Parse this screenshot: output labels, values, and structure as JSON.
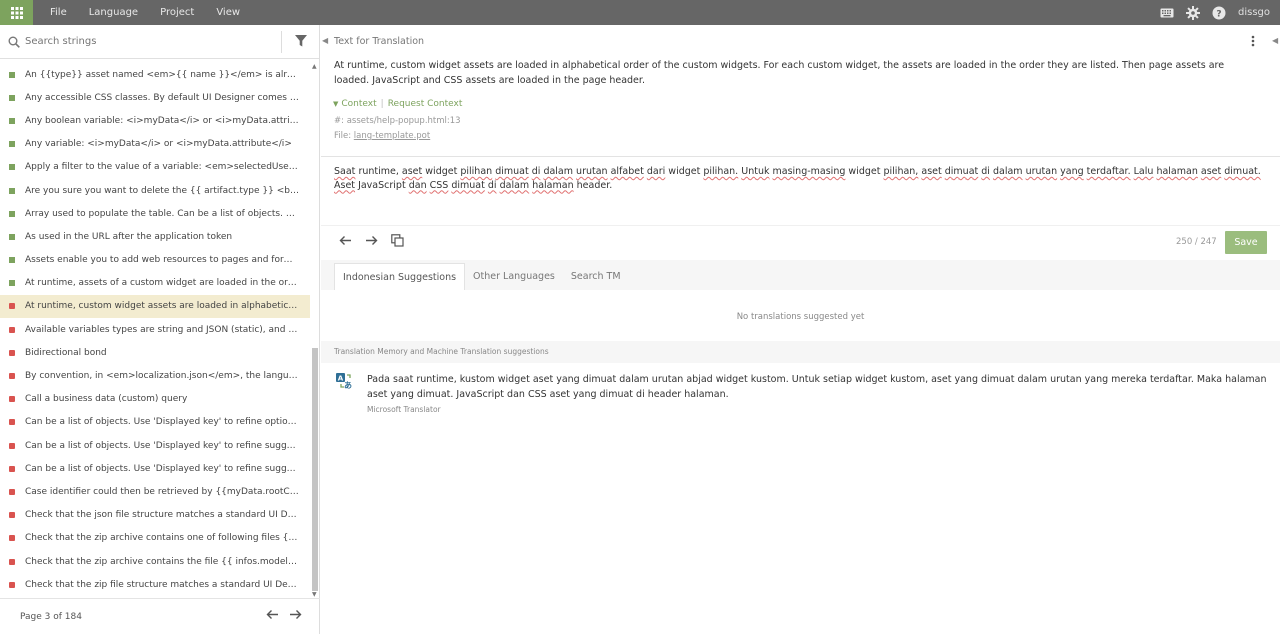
{
  "topbar": {
    "menu": [
      "File",
      "Language",
      "Project",
      "View"
    ],
    "username": "dissgo",
    "icons": [
      "apps-grid-icon",
      "keyboard-icon",
      "gear-icon",
      "help-icon"
    ]
  },
  "sidebar": {
    "search_placeholder": "Search strings",
    "items": [
      {
        "text": "An {{type}} asset named <em>{{ name }}</em> is already added t...",
        "status": "translated"
      },
      {
        "text": "Any accessible CSS classes. By default UI Designer comes with Boo...",
        "status": "translated"
      },
      {
        "text": "Any boolean variable: <i>myData</i> or <i>myData.attribute</i>",
        "status": "translated"
      },
      {
        "text": "Any variable: <i>myData</i> or <i>myData.attribute</i>",
        "status": "translated"
      },
      {
        "text": "Apply a filter to the value of a variable: <em>selectedUser | json</...",
        "status": "translated"
      },
      {
        "text": "Are you sure you want to delete the {{ artifact.type }} <b>{{ artifact...",
        "status": "translated"
      },
      {
        "text": "Array used to populate the table. Can be a list of objects. Use 'Colu...",
        "status": "translated"
      },
      {
        "text": "As used in the URL after the application token",
        "status": "translated"
      },
      {
        "text": "Assets enable you to add web resources to pages and forms. Avail...",
        "status": "translated"
      },
      {
        "text": "At runtime, assets of a custom widget are loaded in the order defi...",
        "status": "translated"
      },
      {
        "text": "At runtime, custom widget assets are loaded in alphabetical order ...",
        "status": "untranslated",
        "active": true
      },
      {
        "text": "Available variables types are string and JSON (static), and External ...",
        "status": "untranslated"
      },
      {
        "text": "Bidirectional bond",
        "status": "untranslated"
      },
      {
        "text": "By convention, in <em>localization.json</em>, the language used ...",
        "status": "untranslated"
      },
      {
        "text": "Call a business data (custom) query",
        "status": "untranslated"
      },
      {
        "text": "Can be a list of objects. Use 'Displayed key' to refine options and 'R...",
        "status": "untranslated"
      },
      {
        "text": "Can be a list of objects. Use 'Displayed key' to refine suggestions",
        "status": "untranslated"
      },
      {
        "text": "Can be a list of objects. Use 'Displayed key' to refine suggestions a...",
        "status": "untranslated"
      },
      {
        "text": "Case identifier could then be retrieved by {{myData.rootCaseId}}",
        "status": "untranslated"
      },
      {
        "text": "Check that the json file structure matches a standard UI Designer ...",
        "status": "untranslated"
      },
      {
        "text": "Check that the zip archive contains one of following files {{ infos.m...",
        "status": "untranslated"
      },
      {
        "text": "Check that the zip archive contains the file {{ infos.modelfile }}.",
        "status": "untranslated"
      },
      {
        "text": "Check that the zip file structure matches a standard UI Designer e...",
        "status": "untranslated"
      }
    ],
    "pagination": "Page 3 of 184"
  },
  "editor": {
    "source_heading": "Text for Translation",
    "source_text": "At runtime, custom widget assets are loaded in alphabetical order of the custom widgets. For each custom widget, the assets are loaded in the order they are listed. Then page assets are loaded. JavaScript and CSS assets are loaded in the page header.",
    "context_label": "Context",
    "request_context_label": "Request Context",
    "reference": "#: assets/help-popup.html:13",
    "file_label": "File:",
    "file_name": "lang-template.pot",
    "translation_text": "Saat runtime, aset widget pilihan dimuat di dalam urutan alfabet dari widget pilihan. Untuk masing-masing widget pilihan, aset dimuat di dalam urutan yang terdaftar. Lalu halaman aset dimuat. Aset JavaScript dan CSS dimuat di dalam halaman header.",
    "char_count": "250 / 247",
    "save_label": "Save"
  },
  "suggestions": {
    "tabs": [
      "Indonesian Suggestions",
      "Other Languages",
      "Search TM"
    ],
    "empty_text": "No translations suggested yet",
    "tm_label": "Translation Memory and Machine Translation suggestions",
    "mt_text": "Pada saat runtime, kustom widget aset yang dimuat dalam urutan abjad widget kustom. Untuk setiap widget kustom, aset yang dimuat dalam urutan yang mereka terdaftar. Maka halaman aset yang dimuat. JavaScript dan CSS aset yang dimuat di header halaman.",
    "mt_source": "Microsoft Translator"
  },
  "colors": {
    "accent": "#7da35e",
    "topbar": "#666666",
    "untranslated": "#d9534f",
    "active_row": "#f3ecd0"
  }
}
